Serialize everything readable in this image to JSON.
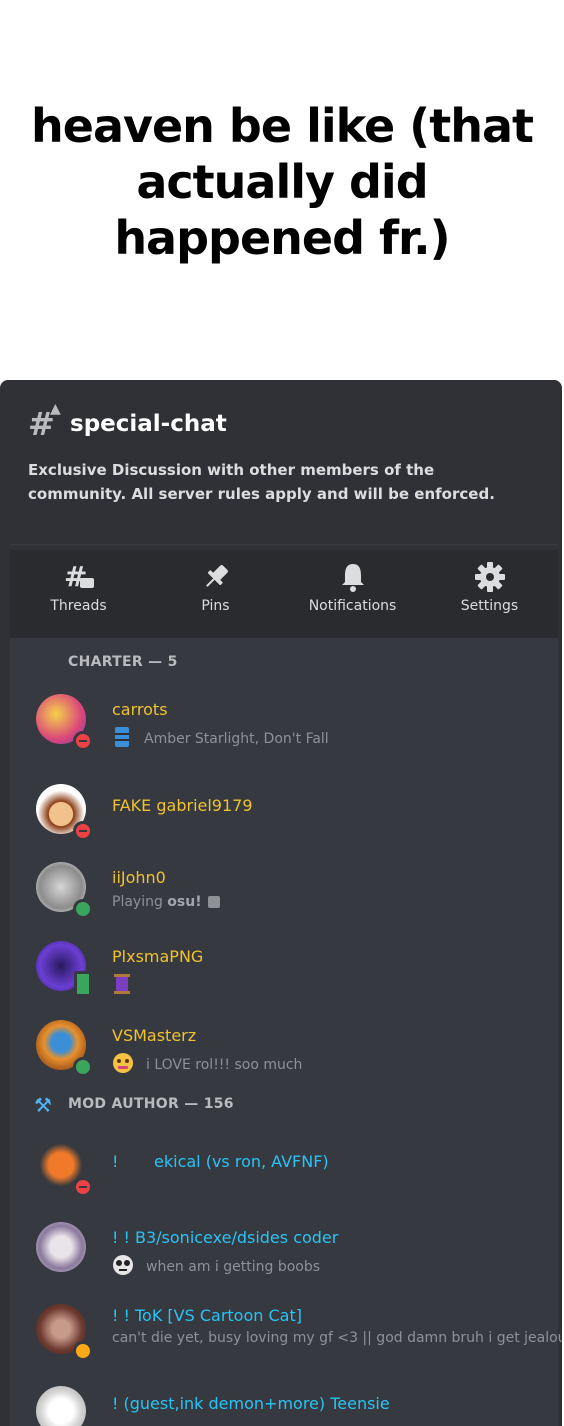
{
  "caption": {
    "line1": "heaven be like (that",
    "line2": "actually did",
    "line3": "happened fr.)"
  },
  "channel": {
    "name": "special-chat",
    "topic": "Exclusive Discussion with other members of the community. All server rules apply and will be enforced."
  },
  "actions": [
    {
      "label": "Threads",
      "icon": "threads-icon"
    },
    {
      "label": "Pins",
      "icon": "pin-icon"
    },
    {
      "label": "Notifications",
      "icon": "bell-icon"
    },
    {
      "label": "Settings",
      "icon": "gear-icon"
    }
  ],
  "sections": {
    "charter": "CHARTER — 5",
    "mod_author": "MOD AUTHOR — 156"
  },
  "members": [
    {
      "name": "carrots",
      "status": "dnd",
      "activity": "Amber Starlight, Don't Fall"
    },
    {
      "name": "FAKE gabriel9179",
      "status": "dnd",
      "activity": ""
    },
    {
      "name": "iiJohn0",
      "status": "online",
      "activity_prefix": "Playing ",
      "activity": "osu!"
    },
    {
      "name": "PlxsmaPNG",
      "status": "mobile",
      "activity": ""
    },
    {
      "name": "VSMasterz",
      "status": "online",
      "activity": "i LOVE rol!!! soo much"
    },
    {
      "name": "!       ekical (vs ron, AVFNF)",
      "status": "dnd",
      "activity": ""
    },
    {
      "name": "! ! B3/sonicexe/dsides coder",
      "status": "none",
      "activity": "when am i getting boobs"
    },
    {
      "name": "! ! ToK [VS Cartoon Cat]",
      "status": "idle",
      "activity": "can't die yet, busy loving my gf <3 || god damn bruh i get jealou..."
    },
    {
      "name": "! (guest,ink demon+more) Teensie",
      "status": "none",
      "activity": ""
    }
  ],
  "colors": {
    "charter_name": "#f0c230",
    "mod_name": "#29c4f6",
    "panel": "#2f3136",
    "list": "#36393f"
  }
}
